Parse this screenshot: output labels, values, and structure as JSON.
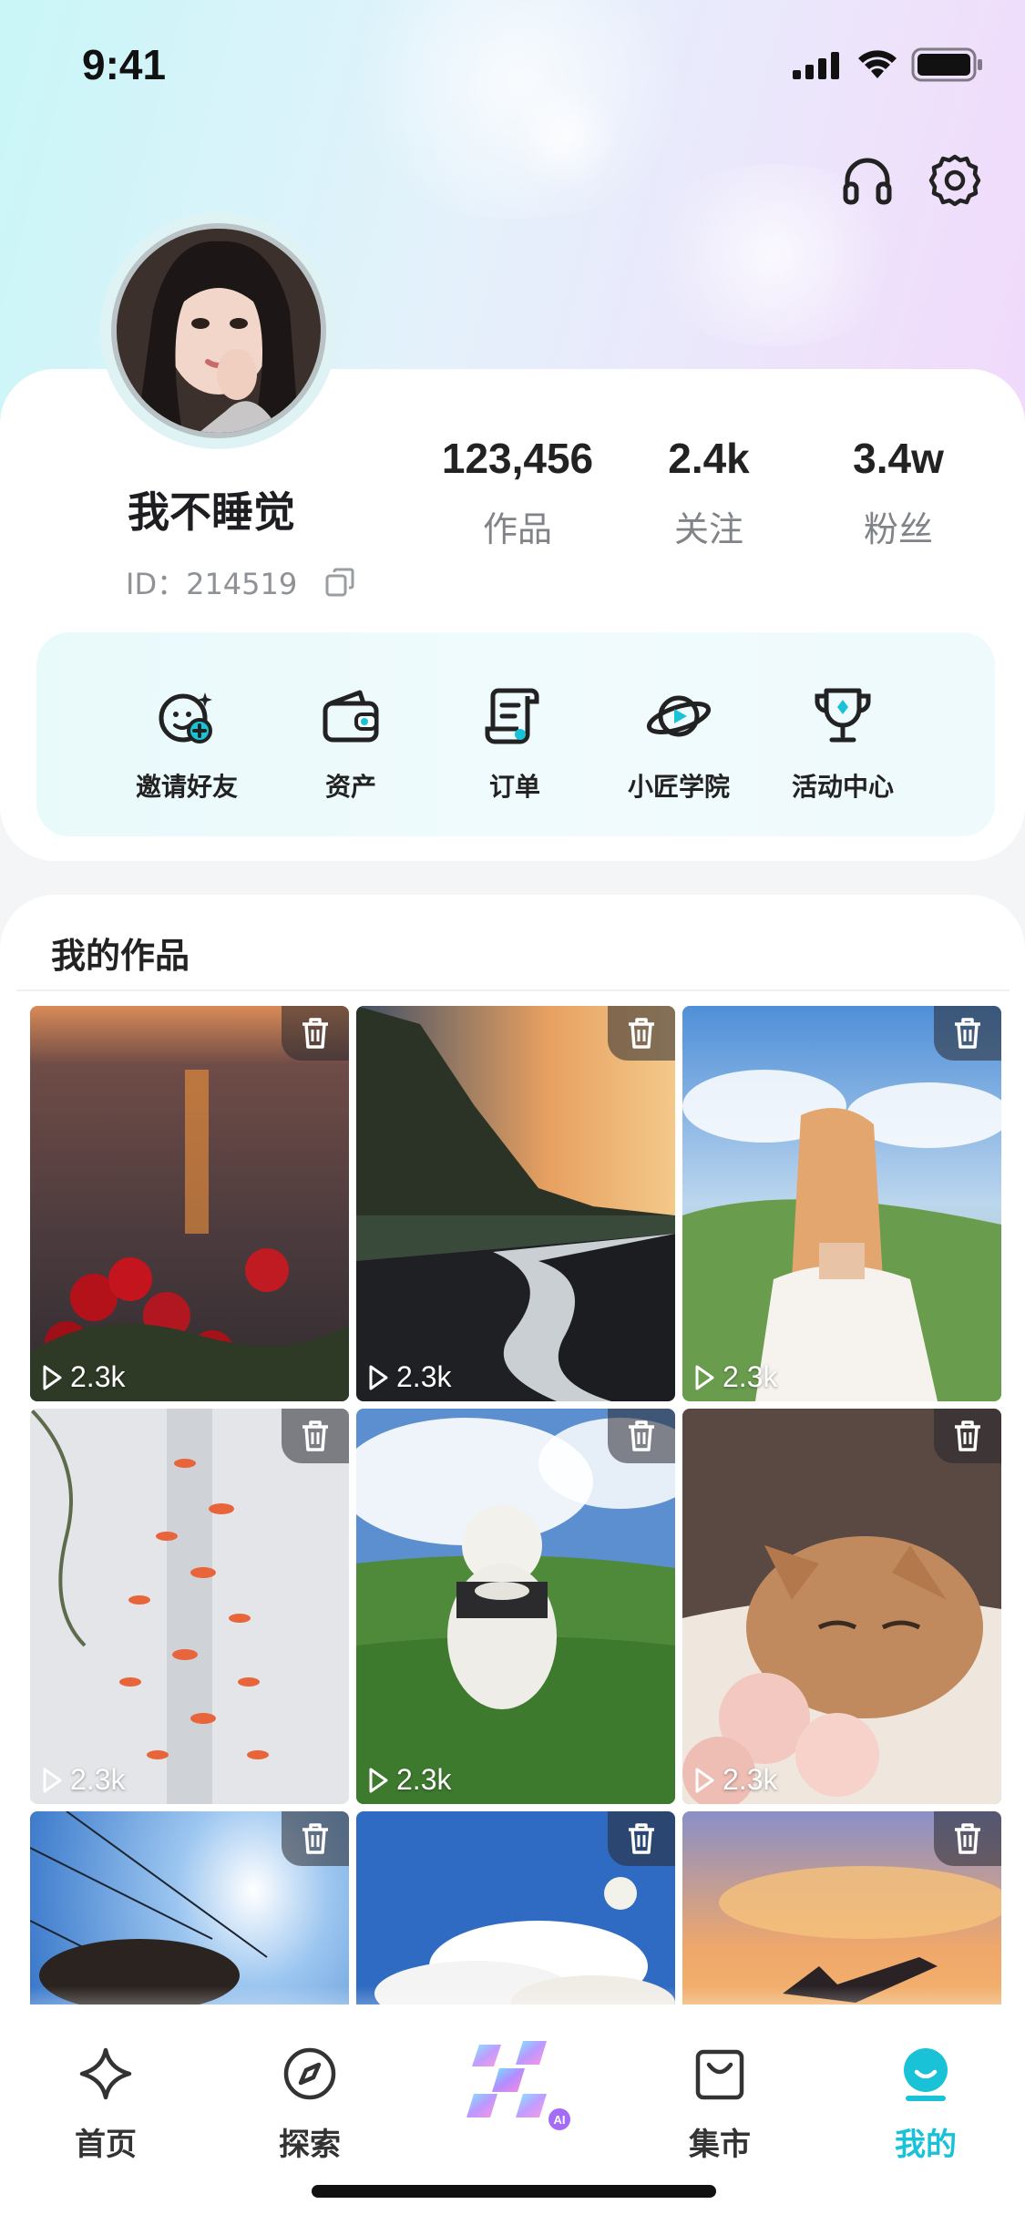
{
  "status_bar": {
    "time": "9:41"
  },
  "profile": {
    "username": "我不睡觉",
    "id_text": "ID：214519"
  },
  "stats": [
    {
      "value": "123,456",
      "label": "作品"
    },
    {
      "value": "2.4k",
      "label": "关注"
    },
    {
      "value": "3.4w",
      "label": "粉丝"
    }
  ],
  "menu": [
    {
      "label": "邀请好友",
      "icon": "invite-friend-icon"
    },
    {
      "label": "资产",
      "icon": "wallet-icon"
    },
    {
      "label": "订单",
      "icon": "order-icon"
    },
    {
      "label": "小匠学院",
      "icon": "academy-planet-icon"
    },
    {
      "label": "活动中心",
      "icon": "trophy-icon"
    }
  ],
  "works": {
    "title": "我的作品",
    "items": [
      {
        "plays": "2.3k",
        "scene": "sunset-sea-roses"
      },
      {
        "plays": "2.3k",
        "scene": "black-sand-beach"
      },
      {
        "plays": "2.3k",
        "scene": "girl-mountains"
      },
      {
        "plays": "2.3k",
        "scene": "koi-fish-wall"
      },
      {
        "plays": "2.3k",
        "scene": "white-dog-grass"
      },
      {
        "plays": "2.3k",
        "scene": "cat-roses"
      },
      {
        "plays": "",
        "scene": "sky-wires"
      },
      {
        "plays": "",
        "scene": "clouds-moon"
      },
      {
        "plays": "",
        "scene": "golden-sky-girl"
      }
    ]
  },
  "tab_bar": {
    "items": [
      {
        "label": "首页",
        "icon": "sparkle-icon",
        "active": false
      },
      {
        "label": "探索",
        "icon": "compass-icon",
        "active": false
      },
      {
        "label": "",
        "icon": "ai-create-icon",
        "active": false
      },
      {
        "label": "集市",
        "icon": "shopping-bag-icon",
        "active": false
      },
      {
        "label": "我的",
        "icon": "smile-face-icon",
        "active": true
      }
    ],
    "ai_badge": "AI"
  },
  "colors": {
    "accent": "#19c2d6",
    "text": "#1f1f24",
    "muted": "#808388"
  }
}
